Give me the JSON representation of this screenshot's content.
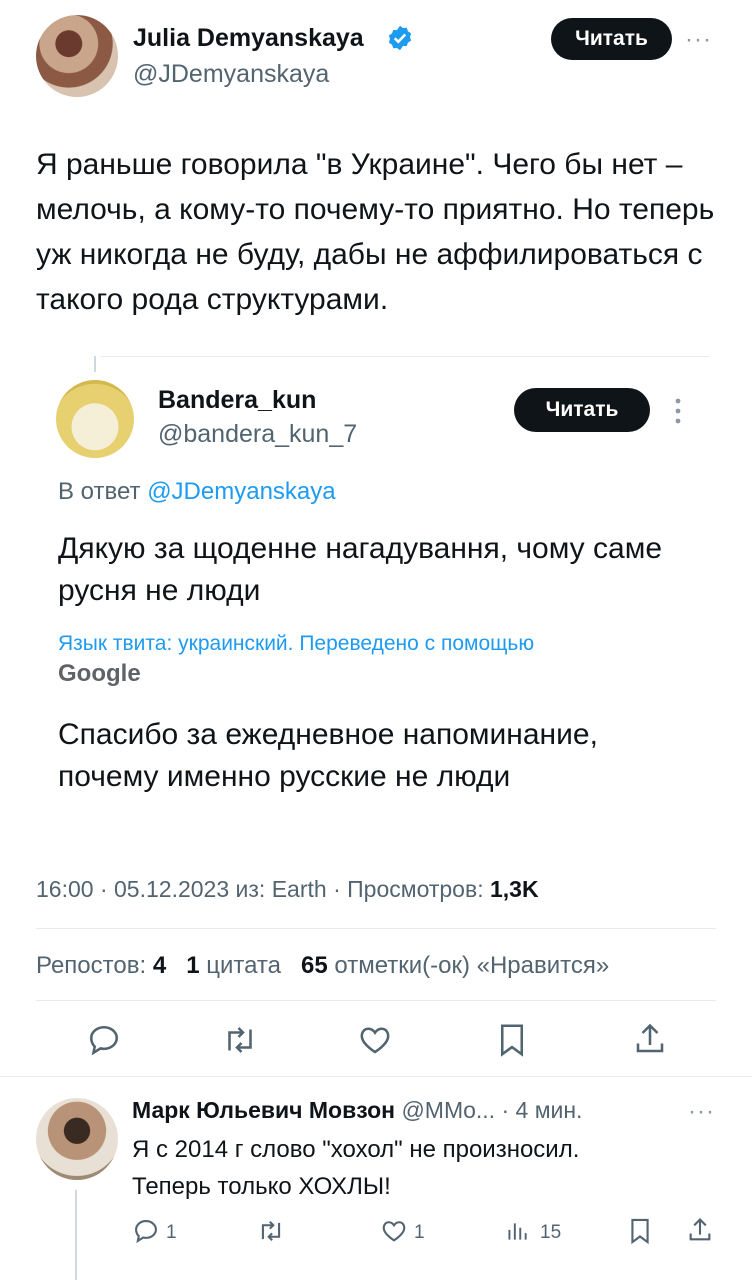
{
  "main_tweet": {
    "author_name": "Julia Demyanskaya",
    "author_handle": "@JDemyanskaya",
    "follow_label": "Читать",
    "more_label": "···",
    "text": "Я раньше говорила \"в Украине\". Чего бы нет – мелочь, а кому-то почему-то приятно. Но теперь уж никогда не буду, дабы не аффилироваться с такого рода структурами."
  },
  "quoted_tweet": {
    "author_name": "Bandera_kun",
    "author_handle": "@bandera_kun_7",
    "follow_label": "Читать",
    "reply_prefix": "В ответ",
    "reply_to": "@JDemyanskaya",
    "text": "Дякую за щоденне нагадування, чому саме русня не люди",
    "translation_note": "Язык твита: украинский. Переведено с помощью",
    "translation_provider": "Google",
    "translated_text": "Спасибо за ежедневное напоминание, почему именно русские не люди"
  },
  "meta": {
    "time": "16:00",
    "date": "05.12.2023",
    "source": "из: Earth",
    "views_label": "Просмотров:",
    "views_value": "1,3K",
    "sep": "·"
  },
  "stats": {
    "reposts_label": "Репостов:",
    "reposts_value": "4",
    "quotes_value": "1",
    "quotes_label": "цитата",
    "likes_value": "65",
    "likes_label": "отметки(-ок) «Нравится»"
  },
  "actions": {
    "icons": [
      "reply-icon",
      "repost-icon",
      "like-icon",
      "bookmark-icon",
      "share-icon"
    ]
  },
  "reply": {
    "author_name": "Марк Юльевич Мовзон",
    "author_handle": "@MMo...",
    "time": "· 4 мин.",
    "more_label": "···",
    "line1": "Я с 2014 г слово \"хохол\" не произносил.",
    "line2": "Теперь только ХОХЛЫ!",
    "reply_count": "1",
    "like_count": "1",
    "views_count": "15"
  },
  "colors": {
    "accent": "#1d9bf0",
    "text": "#0f1419",
    "secondary": "#536471",
    "divider": "#e6ecf0",
    "button": "#0f1419"
  }
}
